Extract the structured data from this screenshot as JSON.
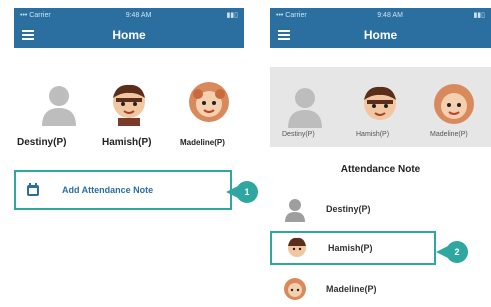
{
  "colors": {
    "primary": "#2b6fa0",
    "accent": "#2ea7a0",
    "strip": "#e6e6e6"
  },
  "left_screen": {
    "status": {
      "carrier": "••• Carrier",
      "time": "9:48 AM",
      "battery": "battery"
    },
    "nav": {
      "title": "Home",
      "menu_icon": "hamburger-icon"
    },
    "students": [
      {
        "name": "Destiny(P)",
        "icon": "default-avatar-icon"
      },
      {
        "name": "Hamish(P)",
        "icon": "boy-avatar-icon"
      },
      {
        "name": "Madeline(P)",
        "icon": "girl-avatar-icon"
      }
    ],
    "add_note": {
      "label": "Add Attendance Note",
      "icon": "calendar-icon"
    },
    "badge": "1"
  },
  "right_screen": {
    "status": {
      "carrier": "••• Carrier",
      "time": "9:48 AM",
      "battery": "battery"
    },
    "nav": {
      "title": "Home",
      "menu_icon": "hamburger-icon"
    },
    "strip_students": [
      {
        "name": "Destiny(P)",
        "icon": "default-avatar-icon"
      },
      {
        "name": "Hamish(P)",
        "icon": "boy-avatar-icon"
      },
      {
        "name": "Madeline(P)",
        "icon": "girl-avatar-icon"
      }
    ],
    "note_title": "Attendance Note",
    "note_list": [
      {
        "name": "Destiny(P)",
        "icon": "default-avatar-icon"
      },
      {
        "name": "Hamish(P)",
        "icon": "boy-avatar-icon",
        "selected": true
      },
      {
        "name": "Madeline(P)",
        "icon": "girl-avatar-icon"
      }
    ],
    "badge": "2"
  }
}
